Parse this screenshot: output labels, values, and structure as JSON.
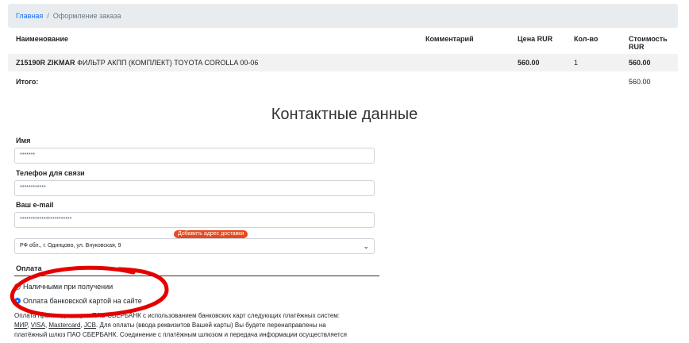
{
  "breadcrumb": {
    "home": "Главная",
    "separator": "/",
    "current": "Оформление заказа"
  },
  "table": {
    "headers": [
      "Наименование",
      "Комментарий",
      "Цена RUR",
      "Кол-во",
      "Стоимость RUR"
    ],
    "item": {
      "code": "Z15190R",
      "brand": "ZIKMAR",
      "description": "ФИЛЬТР АКПП (КОМПЛЕКТ) TOYOTA COROLLA 00-06",
      "comment": "",
      "price": "560.00",
      "qty": "1",
      "cost": "560.00"
    },
    "total_label": "Итого:",
    "total_value": "560.00"
  },
  "contacts": {
    "title": "Контактные данные",
    "name_label": "Имя",
    "name_value": "*******",
    "phone_label": "Телефон для связи",
    "phone_value": "************",
    "email_label": "Ваш e-mail",
    "email_value": "************************",
    "add_address_badge": "Добавить адрес доставки",
    "address_value": "РФ обл., г. Одинцово, ул. Внуковская, 9"
  },
  "payment": {
    "title": "Оплата",
    "options": [
      "Наличными при получении",
      "Оплата банковской картой на сайте"
    ],
    "selected_index": 1,
    "info_line1": "Оплата происходит через ПАО СБЕРБАНК с использованием банковских карт следующих платёжных систем:",
    "card_systems": [
      "МИР",
      "VISA",
      "Mastercard",
      "JCB"
    ],
    "info_line2": "Для оплаты (ввода реквизитов Вашей карты) Вы будете перенаправлены на",
    "info_line3": "платёжный шлюз ПАО СБЕРБАНК. Соединение с платёжным шлюзом и передача информации осуществляется"
  },
  "colors": {
    "link": "#0d6efd",
    "badge": "#e8491d",
    "annotation": "#e50000"
  }
}
